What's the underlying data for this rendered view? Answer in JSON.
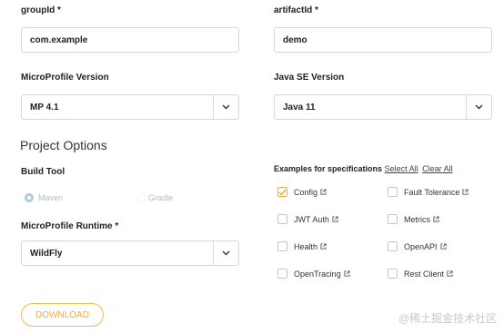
{
  "form": {
    "group_id": {
      "label": "groupId",
      "required_mark": "*",
      "value": "com.example"
    },
    "artifact_id": {
      "label": "artifactId",
      "required_mark": "*",
      "value": "demo"
    },
    "mp_version": {
      "label": "MicroProfile Version",
      "value": "MP 4.1"
    },
    "java_version": {
      "label": "Java SE Version",
      "value": "Java 11"
    }
  },
  "project_options": {
    "title": "Project Options",
    "build_tool": {
      "label": "Build Tool",
      "options": [
        {
          "label": "Maven",
          "selected": true
        },
        {
          "label": "Gradle",
          "selected": false
        }
      ]
    },
    "runtime": {
      "label": "MicroProfile Runtime",
      "required_mark": "*",
      "value": "WildFly"
    }
  },
  "specs": {
    "title": "Examples for specifications",
    "select_all": "Select All",
    "clear_all": "Clear All",
    "items": [
      {
        "label": "Config",
        "checked": true
      },
      {
        "label": "Fault Tolerance",
        "checked": false
      },
      {
        "label": "JWT Auth",
        "checked": false
      },
      {
        "label": "Metrics",
        "checked": false
      },
      {
        "label": "Health",
        "checked": false
      },
      {
        "label": "OpenAPI",
        "checked": false
      },
      {
        "label": "OpenTracing",
        "checked": false
      },
      {
        "label": "Rest Client",
        "checked": false
      }
    ]
  },
  "download_label": "DOWNLOAD",
  "watermark": "@稀土掘金技术社区",
  "icons": {
    "chevron": "chevron-down-icon",
    "external": "external-link-icon",
    "check": "check-icon"
  },
  "colors": {
    "accent": "#f0ad34",
    "radio_selected": "#9ec3e6",
    "checkbox_checked_border": "#f0ad34"
  }
}
